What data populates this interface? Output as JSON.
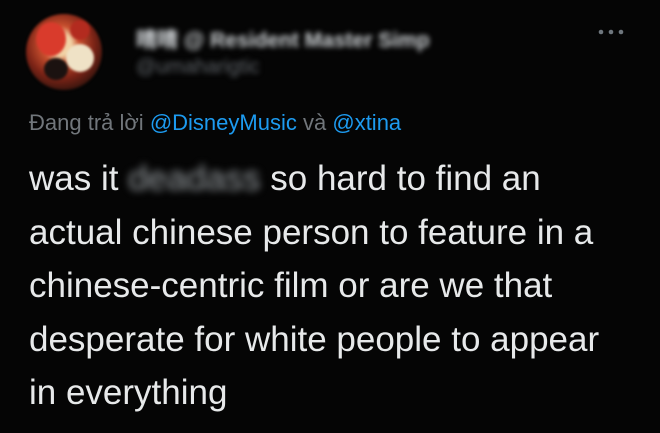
{
  "author": {
    "display_name": "晴晴 @ Resident Master Simp",
    "handle": "@umaharigtic"
  },
  "reply": {
    "prefix": "Đang trả lời",
    "mention1": "@DisneyMusic",
    "joiner": "và",
    "mention2": "@xtina"
  },
  "tweet": {
    "line1_start": "was it",
    "line1_censored": "deadass",
    "line1_end": "so hard to find an",
    "line2": "actual chinese person to feature in a",
    "line3": "chinese-centric film or are we that",
    "line4": "desperate for white people to appear",
    "line5": "in everything"
  },
  "icons": {
    "more": "more-horizontal-icon"
  },
  "colors": {
    "background": "#050505",
    "text": "#e7e9ea",
    "secondary": "#71767b",
    "link": "#1d9bf0"
  }
}
